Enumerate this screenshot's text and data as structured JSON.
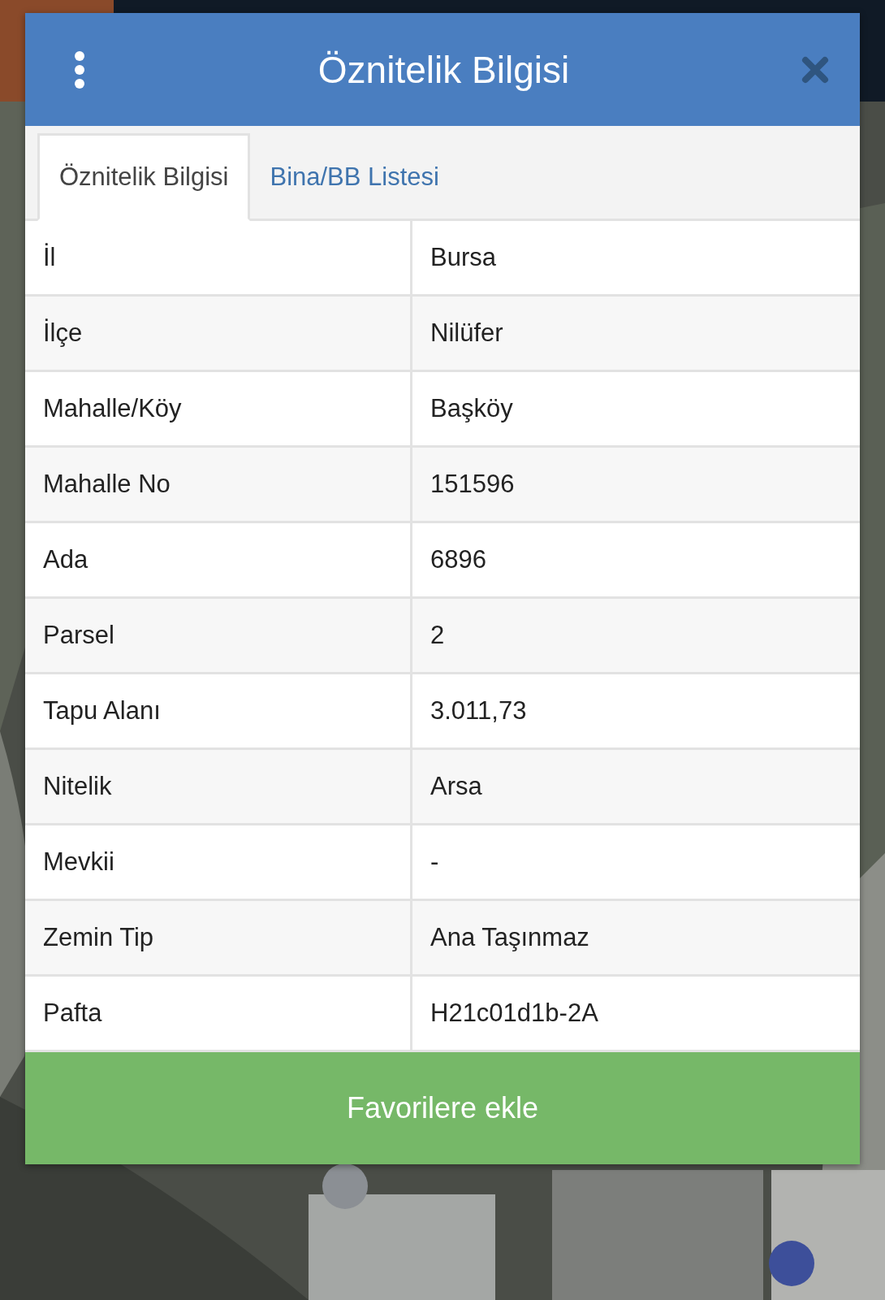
{
  "dialog": {
    "title": "Öznitelik Bilgisi",
    "tabs": [
      {
        "label": "Öznitelik Bilgisi",
        "selected": true
      },
      {
        "label": "Bina/BB Listesi",
        "selected": false
      }
    ],
    "rows": [
      {
        "label": "İl",
        "value": "Bursa"
      },
      {
        "label": "İlçe",
        "value": "Nilüfer"
      },
      {
        "label": "Mahalle/Köy",
        "value": "Başköy"
      },
      {
        "label": "Mahalle No",
        "value": "151596"
      },
      {
        "label": "Ada",
        "value": "6896"
      },
      {
        "label": "Parsel",
        "value": "2"
      },
      {
        "label": "Tapu Alanı",
        "value": "3.011,73"
      },
      {
        "label": "Nitelik",
        "value": "Arsa"
      },
      {
        "label": "Mevkii",
        "value": "-"
      },
      {
        "label": "Zemin Tip",
        "value": "Ana Taşınmaz"
      },
      {
        "label": "Pafta",
        "value": "H21c01d1b-2A"
      }
    ],
    "button": "Favorilere ekle"
  }
}
